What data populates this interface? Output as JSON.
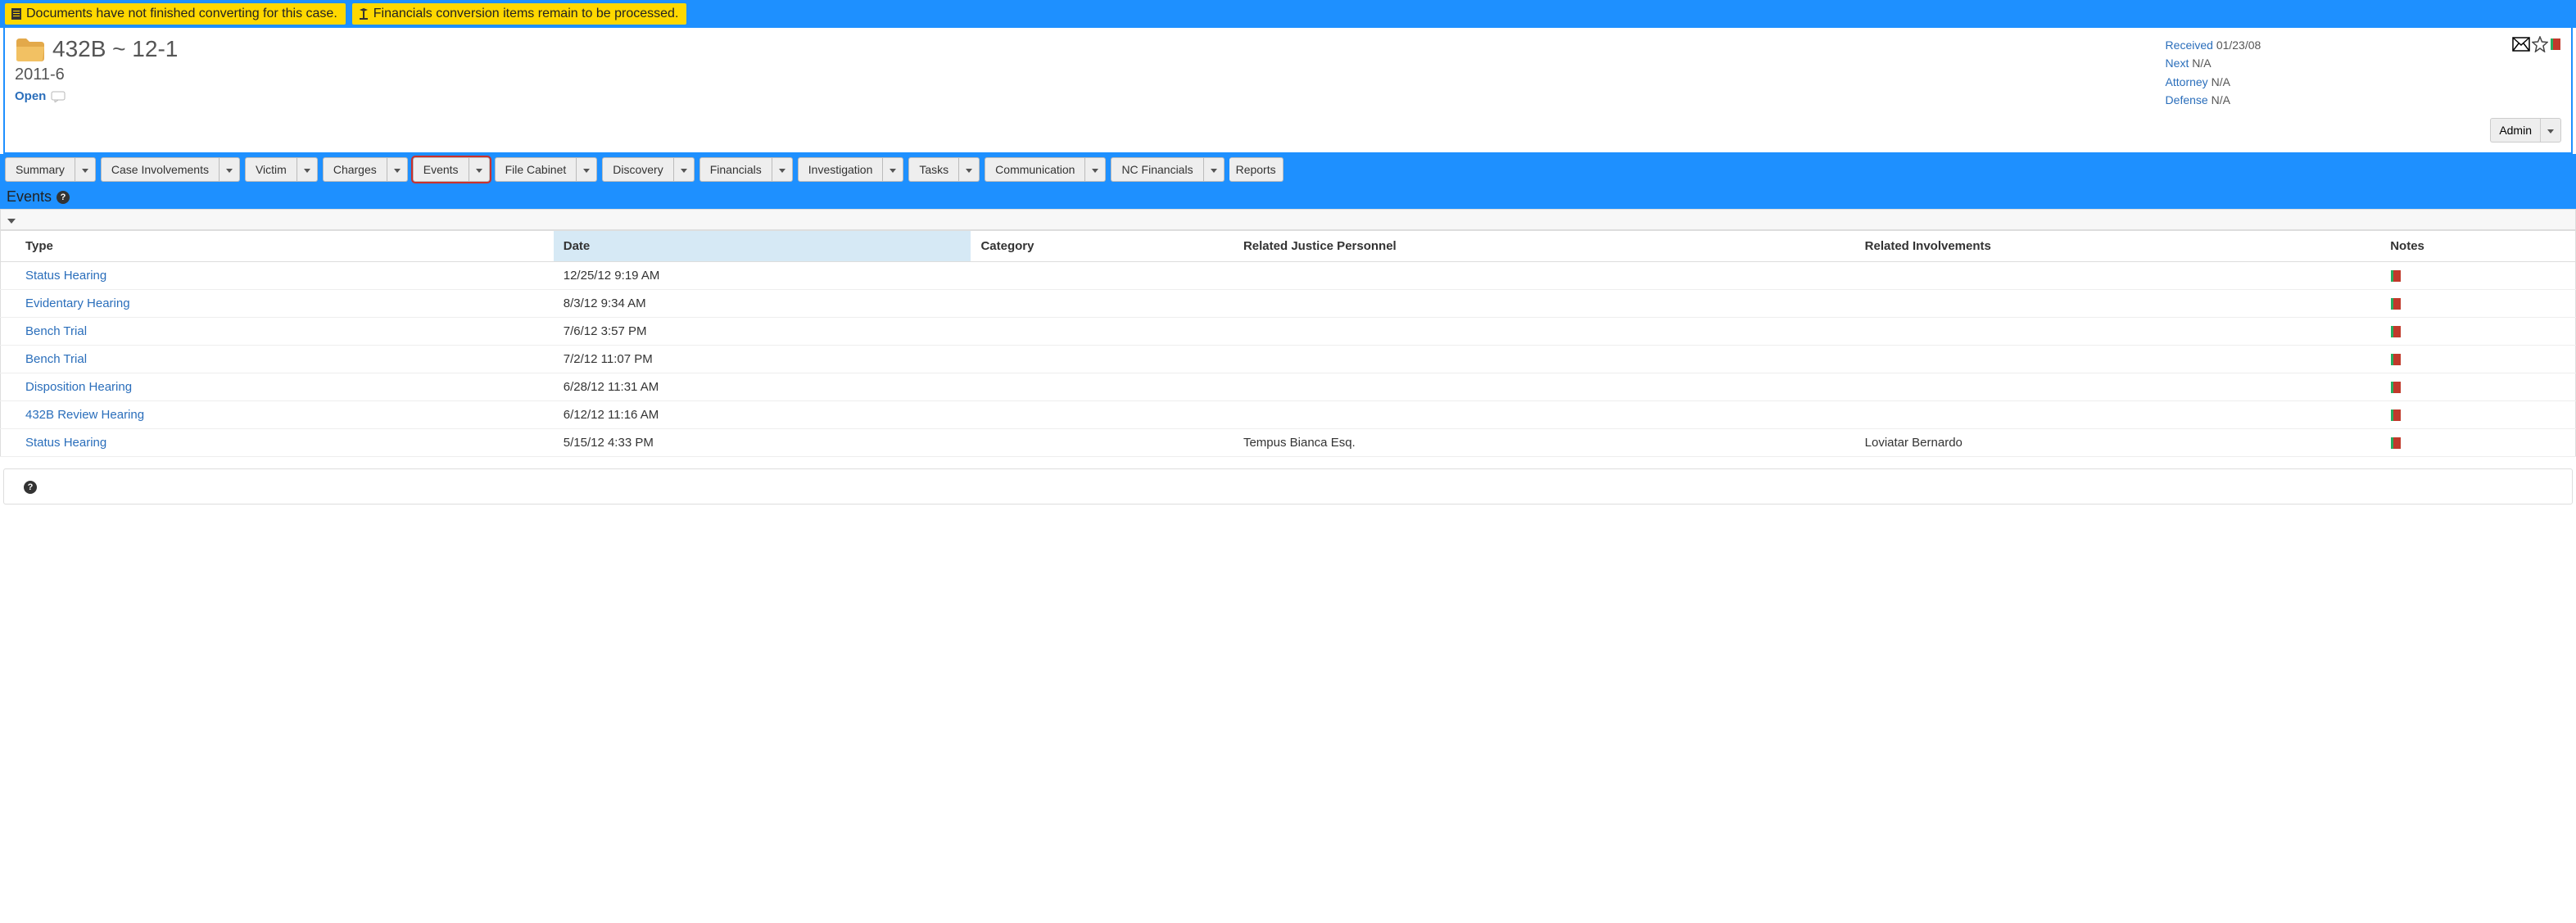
{
  "warnings": {
    "docs": "Documents have not finished converting for this case.",
    "fin": "Financials conversion items remain to be processed."
  },
  "case": {
    "title": "432B ~ 12-1",
    "subtitle": "2011-6",
    "status": "Open"
  },
  "meta": {
    "received_label": "Received",
    "received_value": "01/23/08",
    "next_label": "Next",
    "next_value": "N/A",
    "attorney_label": "Attorney",
    "attorney_value": "N/A",
    "defense_label": "Defense",
    "defense_value": "N/A"
  },
  "admin": {
    "label": "Admin"
  },
  "tabs": {
    "summary": "Summary",
    "involvements": "Case Involvements",
    "victim": "Victim",
    "charges": "Charges",
    "events": "Events",
    "filecabinet": "File Cabinet",
    "discovery": "Discovery",
    "financials": "Financials",
    "investigation": "Investigation",
    "tasks": "Tasks",
    "communication": "Communication",
    "ncfinancials": "NC Financials",
    "reports": "Reports"
  },
  "section": {
    "title": "Events"
  },
  "table": {
    "headers": {
      "type": "Type",
      "date": "Date",
      "category": "Category",
      "personnel": "Related Justice Personnel",
      "involvements": "Related Involvements",
      "notes": "Notes"
    },
    "rows": [
      {
        "type": "Status Hearing",
        "date": "12/25/12 9:19 AM",
        "category": "",
        "personnel": "",
        "involvements": ""
      },
      {
        "type": "Evidentary Hearing",
        "date": "8/3/12 9:34 AM",
        "category": "",
        "personnel": "",
        "involvements": ""
      },
      {
        "type": "Bench Trial",
        "date": "7/6/12 3:57 PM",
        "category": "",
        "personnel": "",
        "involvements": ""
      },
      {
        "type": "Bench Trial",
        "date": "7/2/12 11:07 PM",
        "category": "",
        "personnel": "",
        "involvements": ""
      },
      {
        "type": "Disposition Hearing",
        "date": "6/28/12 11:31 AM",
        "category": "",
        "personnel": "",
        "involvements": ""
      },
      {
        "type": "432B Review Hearing",
        "date": "6/12/12 11:16 AM",
        "category": "",
        "personnel": "",
        "involvements": ""
      },
      {
        "type": "Status Hearing",
        "date": "5/15/12 4:33 PM",
        "category": "",
        "personnel": "Tempus Bianca Esq.",
        "involvements": "Loviatar Bernardo"
      }
    ]
  }
}
